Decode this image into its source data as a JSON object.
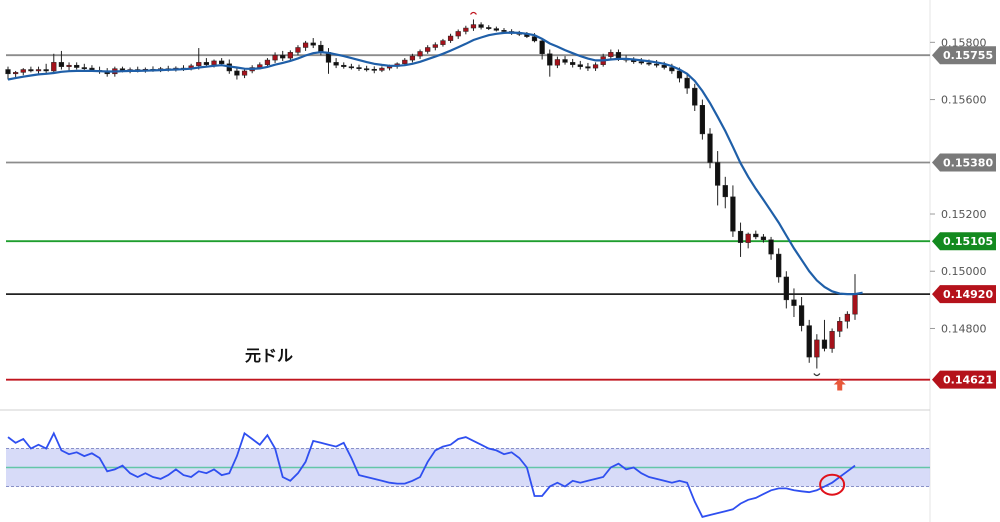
{
  "chart_data": {
    "type": "candlestick",
    "title": "元ドル",
    "ylim": [
      0.1455,
      0.1592
    ],
    "price_ticks": [
      "0.15800",
      "0.15600",
      "0.15200",
      "0.15000",
      "0.14800"
    ],
    "horizontal_levels": [
      {
        "label": "0.15755",
        "value": 0.15755,
        "color": "#8c8c8c",
        "tag_color": "#7a7a7a"
      },
      {
        "label": "0.15380",
        "value": 0.1538,
        "color": "#8c8c8c",
        "tag_color": "#7a7a7a"
      },
      {
        "label": "0.15105",
        "value": 0.15105,
        "color": "#1e9e2e",
        "tag_color": "#138a1f"
      },
      {
        "label": "0.14920",
        "value": 0.1492,
        "color": "#222222",
        "tag_color": "#b5121b"
      },
      {
        "label": "0.14621",
        "value": 0.14621,
        "color": "#c0151e",
        "tag_color": "#b5121b"
      }
    ],
    "candles": [
      [
        0.15705,
        0.15715,
        0.1567,
        0.1569
      ],
      [
        0.1569,
        0.157,
        0.15675,
        0.15695
      ],
      [
        0.15695,
        0.1571,
        0.15685,
        0.15705
      ],
      [
        0.15705,
        0.15715,
        0.15695,
        0.157
      ],
      [
        0.157,
        0.15715,
        0.1569,
        0.15705
      ],
      [
        0.15705,
        0.15725,
        0.1569,
        0.157
      ],
      [
        0.157,
        0.1576,
        0.1569,
        0.1573
      ],
      [
        0.1573,
        0.1577,
        0.15705,
        0.15715
      ],
      [
        0.15715,
        0.1573,
        0.157,
        0.1572
      ],
      [
        0.1572,
        0.1573,
        0.15705,
        0.15712
      ],
      [
        0.15712,
        0.15725,
        0.157,
        0.1571
      ],
      [
        0.1571,
        0.1572,
        0.15698,
        0.15702
      ],
      [
        0.15702,
        0.15715,
        0.1569,
        0.157
      ],
      [
        0.157,
        0.1571,
        0.1568,
        0.1569
      ],
      [
        0.1569,
        0.15715,
        0.1568,
        0.15708
      ],
      [
        0.15708,
        0.15715,
        0.15695,
        0.157
      ],
      [
        0.157,
        0.15712,
        0.15692,
        0.15705
      ],
      [
        0.15705,
        0.15715,
        0.15695,
        0.15702
      ],
      [
        0.15702,
        0.15712,
        0.15694,
        0.15706
      ],
      [
        0.15706,
        0.15716,
        0.15697,
        0.15704
      ],
      [
        0.15704,
        0.15714,
        0.15696,
        0.15708
      ],
      [
        0.15708,
        0.15718,
        0.15698,
        0.15706
      ],
      [
        0.15706,
        0.15716,
        0.15698,
        0.1571
      ],
      [
        0.1571,
        0.1572,
        0.157,
        0.15708
      ],
      [
        0.15708,
        0.15725,
        0.15702,
        0.15718
      ],
      [
        0.15718,
        0.1578,
        0.15705,
        0.1573
      ],
      [
        0.1573,
        0.15745,
        0.15715,
        0.15722
      ],
      [
        0.15722,
        0.1574,
        0.15712,
        0.15735
      ],
      [
        0.15735,
        0.15745,
        0.15718,
        0.15725
      ],
      [
        0.15725,
        0.1574,
        0.1569,
        0.157
      ],
      [
        0.157,
        0.15715,
        0.1567,
        0.15685
      ],
      [
        0.15685,
        0.15705,
        0.15675,
        0.157
      ],
      [
        0.157,
        0.1572,
        0.15692,
        0.15712
      ],
      [
        0.15712,
        0.1573,
        0.15705,
        0.15722
      ],
      [
        0.15722,
        0.15745,
        0.15715,
        0.15738
      ],
      [
        0.15738,
        0.15765,
        0.15728,
        0.15755
      ],
      [
        0.15755,
        0.1577,
        0.15735,
        0.15745
      ],
      [
        0.15745,
        0.15772,
        0.15738,
        0.15765
      ],
      [
        0.15765,
        0.1579,
        0.15755,
        0.15782
      ],
      [
        0.15782,
        0.15805,
        0.1577,
        0.15798
      ],
      [
        0.15798,
        0.15815,
        0.1578,
        0.1579
      ],
      [
        0.1579,
        0.15805,
        0.15755,
        0.15765
      ],
      [
        0.15765,
        0.1578,
        0.1569,
        0.1573
      ],
      [
        0.1573,
        0.15745,
        0.1571,
        0.1572
      ],
      [
        0.1572,
        0.1573,
        0.15708,
        0.15715
      ],
      [
        0.15715,
        0.15725,
        0.15705,
        0.15712
      ],
      [
        0.15712,
        0.15722,
        0.157,
        0.15708
      ],
      [
        0.15708,
        0.15718,
        0.15698,
        0.15706
      ],
      [
        0.15706,
        0.15716,
        0.15692,
        0.15702
      ],
      [
        0.15702,
        0.15716,
        0.15696,
        0.1571
      ],
      [
        0.1571,
        0.15722,
        0.15702,
        0.15716
      ],
      [
        0.15716,
        0.1573,
        0.15708,
        0.15725
      ],
      [
        0.15725,
        0.15745,
        0.15718,
        0.15738
      ],
      [
        0.15738,
        0.1576,
        0.1573,
        0.15752
      ],
      [
        0.15752,
        0.15775,
        0.15742,
        0.15768
      ],
      [
        0.15768,
        0.1579,
        0.1576,
        0.15782
      ],
      [
        0.15782,
        0.158,
        0.15772,
        0.15792
      ],
      [
        0.15792,
        0.15812,
        0.15785,
        0.15806
      ],
      [
        0.15806,
        0.1583,
        0.15798,
        0.15822
      ],
      [
        0.15822,
        0.15845,
        0.15812,
        0.15838
      ],
      [
        0.15838,
        0.15858,
        0.15828,
        0.1585
      ],
      [
        0.1585,
        0.1588,
        0.1584,
        0.15862
      ],
      [
        0.15862,
        0.1587,
        0.15845,
        0.15852
      ],
      [
        0.15852,
        0.1586,
        0.15843,
        0.15848
      ],
      [
        0.15848,
        0.15855,
        0.15838,
        0.15842
      ],
      [
        0.15842,
        0.1585,
        0.15832,
        0.15838
      ],
      [
        0.15838,
        0.15846,
        0.15826,
        0.15832
      ],
      [
        0.15832,
        0.1584,
        0.15822,
        0.15828
      ],
      [
        0.15828,
        0.15836,
        0.15815,
        0.1582
      ],
      [
        0.1582,
        0.15832,
        0.158,
        0.15805
      ],
      [
        0.15805,
        0.15815,
        0.1574,
        0.1576
      ],
      [
        0.1576,
        0.15775,
        0.1568,
        0.1572
      ],
      [
        0.1572,
        0.1575,
        0.1571,
        0.1574
      ],
      [
        0.1574,
        0.15752,
        0.15722,
        0.1573
      ],
      [
        0.1573,
        0.15742,
        0.15712,
        0.15722
      ],
      [
        0.15722,
        0.15735,
        0.15705,
        0.15715
      ],
      [
        0.15715,
        0.15728,
        0.157,
        0.1571
      ],
      [
        0.1571,
        0.1573,
        0.157,
        0.15722
      ],
      [
        0.15722,
        0.1576,
        0.15715,
        0.1575
      ],
      [
        0.1575,
        0.15775,
        0.1574,
        0.15765
      ],
      [
        0.15765,
        0.15775,
        0.15735,
        0.15742
      ],
      [
        0.15742,
        0.15755,
        0.1573,
        0.15738
      ],
      [
        0.15738,
        0.15748,
        0.15725,
        0.15732
      ],
      [
        0.15732,
        0.15745,
        0.15722,
        0.15728
      ],
      [
        0.15728,
        0.1574,
        0.15718,
        0.15724
      ],
      [
        0.15724,
        0.15738,
        0.15712,
        0.1572
      ],
      [
        0.1572,
        0.15732,
        0.15705,
        0.15712
      ],
      [
        0.15712,
        0.15725,
        0.1569,
        0.157
      ],
      [
        0.157,
        0.15712,
        0.1566,
        0.15675
      ],
      [
        0.15675,
        0.1569,
        0.1562,
        0.1564
      ],
      [
        0.1564,
        0.15655,
        0.1556,
        0.1558
      ],
      [
        0.1558,
        0.156,
        0.1546,
        0.1548
      ],
      [
        0.1548,
        0.155,
        0.1536,
        0.1538
      ],
      [
        0.1538,
        0.1542,
        0.1523,
        0.153
      ],
      [
        0.153,
        0.1533,
        0.1522,
        0.1526
      ],
      [
        0.1526,
        0.153,
        0.1512,
        0.1514
      ],
      [
        0.1514,
        0.1517,
        0.1505,
        0.151
      ],
      [
        0.151,
        0.15135,
        0.1508,
        0.1513
      ],
      [
        0.1513,
        0.15142,
        0.15112,
        0.1512
      ],
      [
        0.1512,
        0.1513,
        0.151,
        0.1511
      ],
      [
        0.1511,
        0.1512,
        0.1504,
        0.1506
      ],
      [
        0.1506,
        0.1508,
        0.1496,
        0.1498
      ],
      [
        0.1498,
        0.15,
        0.1487,
        0.149
      ],
      [
        0.149,
        0.1494,
        0.1484,
        0.1488
      ],
      [
        0.1488,
        0.1491,
        0.1479,
        0.1481
      ],
      [
        0.1481,
        0.1483,
        0.1468,
        0.147
      ],
      [
        0.147,
        0.1478,
        0.1466,
        0.1476
      ],
      [
        0.1476,
        0.1483,
        0.1472,
        0.1473
      ],
      [
        0.1473,
        0.148,
        0.14715,
        0.1479
      ],
      [
        0.1479,
        0.1484,
        0.1477,
        0.14825
      ],
      [
        0.14825,
        0.1486,
        0.148,
        0.1485
      ],
      [
        0.1485,
        0.1499,
        0.1483,
        0.1492
      ]
    ],
    "ma": [
      0.1567,
      0.15675,
      0.1568,
      0.15684,
      0.15688,
      0.1569,
      0.15693,
      0.15697,
      0.15699,
      0.157,
      0.157,
      0.157,
      0.15699,
      0.15698,
      0.15698,
      0.15699,
      0.157,
      0.157,
      0.15701,
      0.15702,
      0.15703,
      0.15704,
      0.15705,
      0.15706,
      0.15708,
      0.15712,
      0.15715,
      0.15718,
      0.1572,
      0.15716,
      0.15712,
      0.15708,
      0.15707,
      0.15709,
      0.15714,
      0.15722,
      0.15728,
      0.15735,
      0.15744,
      0.15754,
      0.15762,
      0.15766,
      0.15763,
      0.15758,
      0.15752,
      0.15745,
      0.15738,
      0.15731,
      0.15725,
      0.15721,
      0.15718,
      0.15718,
      0.1572,
      0.15725,
      0.15732,
      0.15741,
      0.1575,
      0.1576,
      0.15771,
      0.15783,
      0.15795,
      0.15808,
      0.15817,
      0.15825,
      0.1583,
      0.15833,
      0.15834,
      0.15833,
      0.1583,
      0.15825,
      0.15812,
      0.15796,
      0.15785,
      0.15773,
      0.15762,
      0.15752,
      0.15743,
      0.15737,
      0.15737,
      0.1574,
      0.15742,
      0.15742,
      0.1574,
      0.15737,
      0.15734,
      0.1573,
      0.15725,
      0.15717,
      0.15705,
      0.1569,
      0.15665,
      0.1563,
      0.15588,
      0.1554,
      0.1549,
      0.15435,
      0.15378,
      0.1533,
      0.15288,
      0.1525,
      0.1521,
      0.1517,
      0.15125,
      0.1508,
      0.1504,
      0.15,
      0.14968,
      0.14945,
      0.1493,
      0.14922,
      0.1492,
      0.1492,
      0.14925
    ],
    "oscillator": {
      "band": [
        0.3,
        0.7
      ],
      "midline": 0.5,
      "values": [
        0.82,
        0.76,
        0.8,
        0.7,
        0.74,
        0.7,
        0.86,
        0.68,
        0.64,
        0.66,
        0.62,
        0.65,
        0.6,
        0.46,
        0.48,
        0.52,
        0.44,
        0.4,
        0.44,
        0.4,
        0.38,
        0.42,
        0.48,
        0.42,
        0.4,
        0.46,
        0.44,
        0.48,
        0.42,
        0.44,
        0.62,
        0.86,
        0.8,
        0.74,
        0.84,
        0.7,
        0.4,
        0.36,
        0.44,
        0.56,
        0.78,
        0.76,
        0.74,
        0.72,
        0.76,
        0.6,
        0.42,
        0.4,
        0.38,
        0.36,
        0.34,
        0.33,
        0.33,
        0.36,
        0.4,
        0.56,
        0.68,
        0.72,
        0.74,
        0.8,
        0.82,
        0.78,
        0.74,
        0.7,
        0.68,
        0.64,
        0.66,
        0.6,
        0.5,
        0.2,
        0.2,
        0.3,
        0.34,
        0.3,
        0.36,
        0.34,
        0.36,
        0.38,
        0.4,
        0.5,
        0.54,
        0.48,
        0.5,
        0.44,
        0.4,
        0.38,
        0.36,
        0.34,
        0.36,
        0.34,
        0.14,
        -0.02,
        0.0,
        0.02,
        0.04,
        0.06,
        0.12,
        0.16,
        0.18,
        0.22,
        0.26,
        0.28,
        0.28,
        0.26,
        0.25,
        0.24,
        0.26,
        0.3,
        0.34,
        0.4,
        0.46,
        0.52
      ]
    }
  }
}
